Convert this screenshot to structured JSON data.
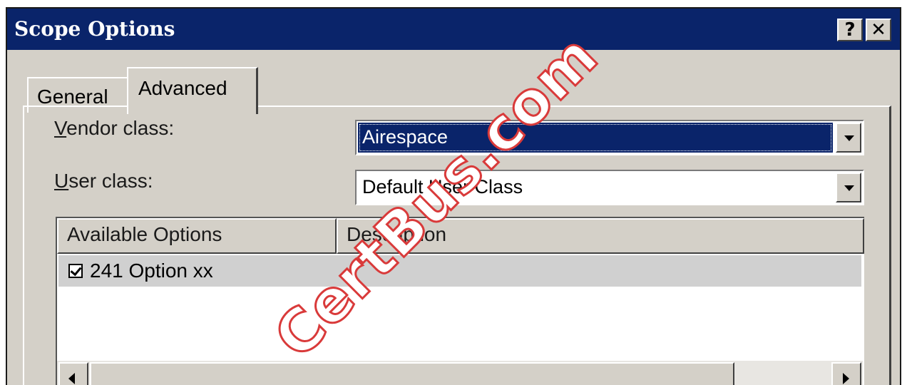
{
  "window": {
    "title": "Scope Options",
    "help_label": "?",
    "close_label": "✕"
  },
  "tabs": [
    {
      "label": "General",
      "active": false
    },
    {
      "label": "Advanced",
      "active": true
    }
  ],
  "vendor_class": {
    "label_accel": "V",
    "label_rest": "endor class:",
    "value": "Airespace"
  },
  "user_class": {
    "label_accel": "U",
    "label_rest": "ser class:",
    "value": "Default User Class"
  },
  "options_list": {
    "columns": [
      "Available Options",
      "Description"
    ],
    "rows": [
      {
        "checked": true,
        "option": "241 Option xx",
        "description": ""
      }
    ]
  },
  "watermark": "CertBus.com",
  "colors": {
    "titlebar": "#0a246a",
    "dialog_face": "#d4d0c8",
    "selection": "#0a246a",
    "watermark_stroke": "#d93a3a"
  },
  "icons": {
    "help": "question-mark-icon",
    "close": "close-icon",
    "dropdown": "chevron-down-icon",
    "scroll_left": "arrow-left-icon",
    "scroll_right": "arrow-right-icon",
    "checkbox": "checkbox-checked-icon"
  }
}
